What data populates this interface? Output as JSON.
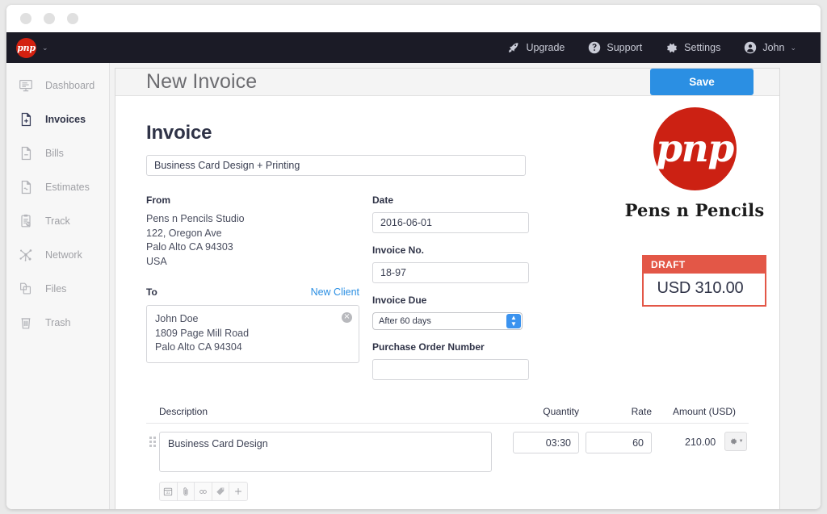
{
  "window": {
    "traffic_lights": [
      "close",
      "minimize",
      "zoom"
    ]
  },
  "topnav": {
    "brand_logo_text": "pnp",
    "brand_caret": "⌄",
    "items": [
      {
        "label": "Upgrade",
        "icon": "rocket-icon"
      },
      {
        "label": "Support",
        "icon": "help-circle-icon"
      },
      {
        "label": "Settings",
        "icon": "gear-icon"
      },
      {
        "label": "John",
        "icon": "user-circle-icon",
        "caret": "⌄"
      }
    ]
  },
  "sidebar": {
    "items": [
      {
        "label": "Dashboard",
        "icon": "dashboard-icon",
        "active": false
      },
      {
        "label": "Invoices",
        "icon": "invoice-plus-icon",
        "active": true
      },
      {
        "label": "Bills",
        "icon": "bill-minus-icon",
        "active": false
      },
      {
        "label": "Estimates",
        "icon": "estimate-icon",
        "active": false
      },
      {
        "label": "Track",
        "icon": "clipboard-check-icon",
        "active": false
      },
      {
        "label": "Network",
        "icon": "network-icon",
        "active": false
      },
      {
        "label": "Files",
        "icon": "files-icon",
        "active": false
      },
      {
        "label": "Trash",
        "icon": "trash-icon",
        "active": false
      }
    ]
  },
  "header": {
    "title": "New Invoice",
    "save_label": "Save"
  },
  "invoice": {
    "heading": "Invoice",
    "title_value": "Business Card Design + Printing",
    "title_placeholder": "",
    "from_label": "From",
    "from_lines": [
      "Pens n Pencils Studio",
      "122, Oregon Ave",
      "Palo Alto CA 94303",
      "USA"
    ],
    "to_label": "To",
    "new_client_label": "New Client",
    "to_lines": [
      "John Doe",
      "1809 Page Mill Road",
      "Palo Alto CA 94304"
    ],
    "to_clear_icon": "×",
    "date_label": "Date",
    "date_value": "2016-06-01",
    "invoice_no_label": "Invoice No.",
    "invoice_no_value": "18-97",
    "invoice_due_label": "Invoice Due",
    "invoice_due_value": "After 60 days",
    "invoice_due_options": [
      "After 60 days"
    ],
    "po_label": "Purchase Order Number",
    "po_value": "",
    "po_placeholder": ""
  },
  "branding": {
    "logo_mark": "pnp",
    "company_name": "Pens n Pencils"
  },
  "status": {
    "badge": "DRAFT",
    "amount": "USD 310.00",
    "accent_color": "#e35747"
  },
  "items_table": {
    "columns": {
      "description": "Description",
      "quantity": "Quantity",
      "rate": "Rate",
      "amount": "Amount (USD)"
    },
    "rows": [
      {
        "description": "Business Card Design",
        "quantity": "03:30",
        "rate": "60",
        "amount": "210.00"
      }
    ],
    "row_tools": [
      {
        "name": "calendar-icon",
        "glyph": "31"
      },
      {
        "name": "paperclip-icon"
      },
      {
        "name": "link-icon"
      },
      {
        "name": "tag-icon"
      },
      {
        "name": "plus-icon"
      }
    ],
    "row_menu_icon": "gear-caret-icon"
  },
  "colors": {
    "accent_blue": "#2b8fe3",
    "brand_red": "#cc2113",
    "status_red": "#e35747",
    "topnav_dark": "#1b1b26",
    "text_dark": "#2f3347"
  }
}
